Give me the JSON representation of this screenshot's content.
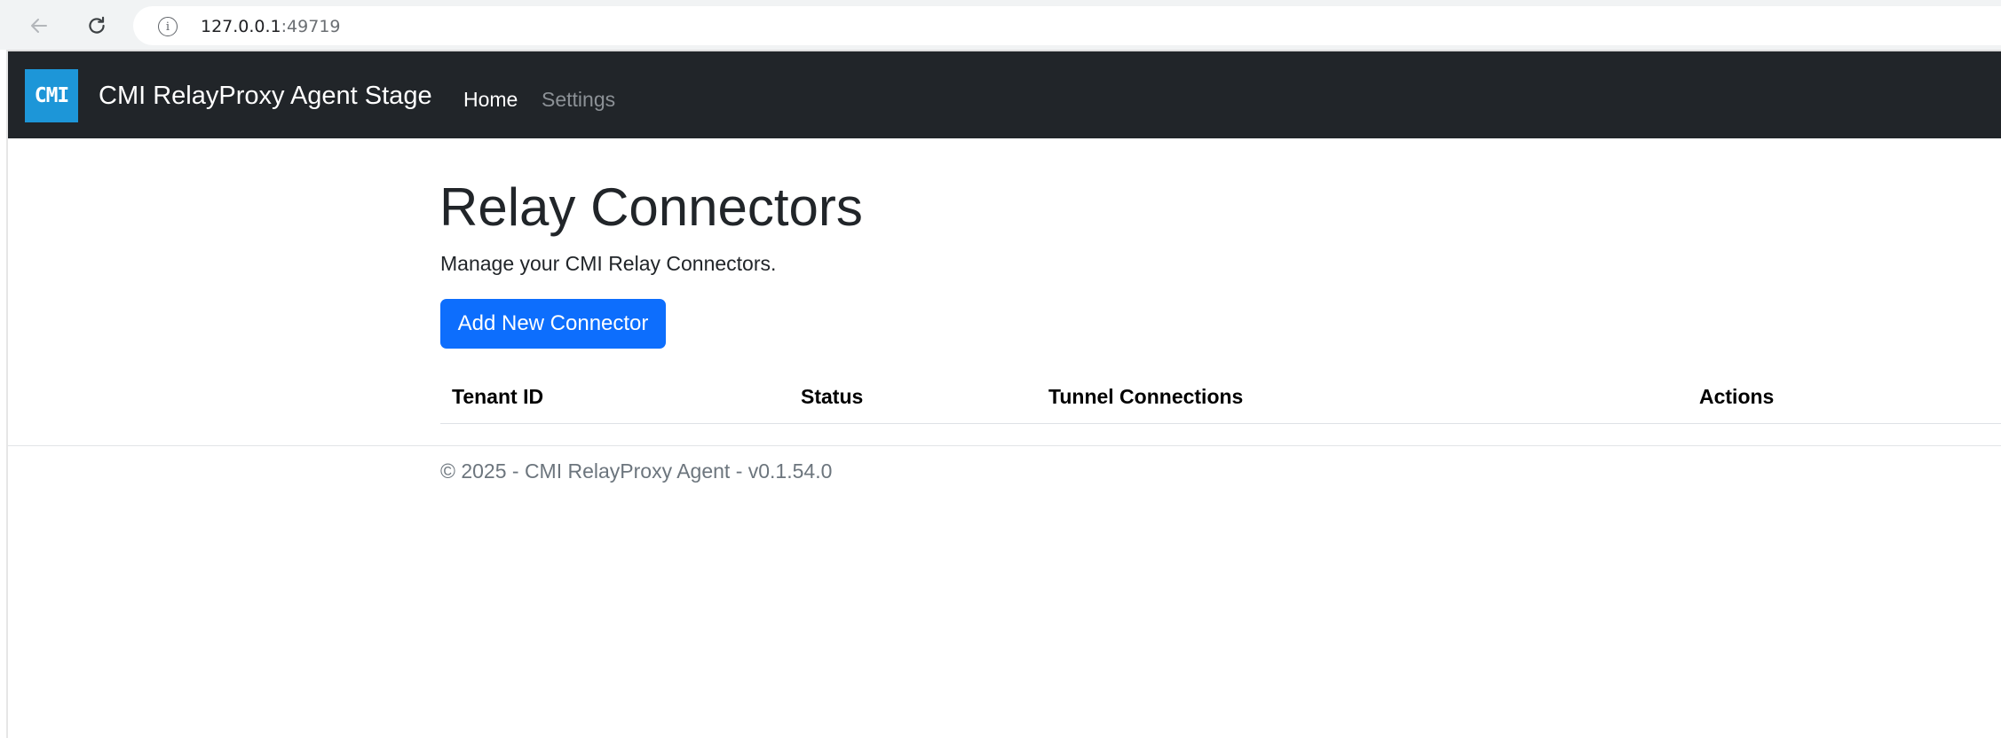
{
  "browser": {
    "url_host": "127.0.0.1",
    "url_port": ":49719",
    "back_icon": "arrow-left-icon",
    "reload_icon": "reload-icon",
    "info_icon": "info-icon",
    "info_glyph": "i"
  },
  "navbar": {
    "logo_text": "CMI",
    "logo_color": "#1d96d8",
    "brand_name": "CMI RelayProxy Agent Stage",
    "links": [
      {
        "label": "Home",
        "active": true
      },
      {
        "label": "Settings",
        "active": false
      }
    ]
  },
  "main": {
    "title": "Relay Connectors",
    "subtitle": "Manage your CMI Relay Connectors.",
    "add_button_label": "Add New Connector",
    "accent_color": "#0d6efd",
    "table": {
      "columns": [
        "Tenant ID",
        "Status",
        "Tunnel Connections",
        "Actions"
      ],
      "rows": []
    }
  },
  "footer": {
    "text": "© 2025 - CMI RelayProxy Agent - v0.1.54.0"
  }
}
